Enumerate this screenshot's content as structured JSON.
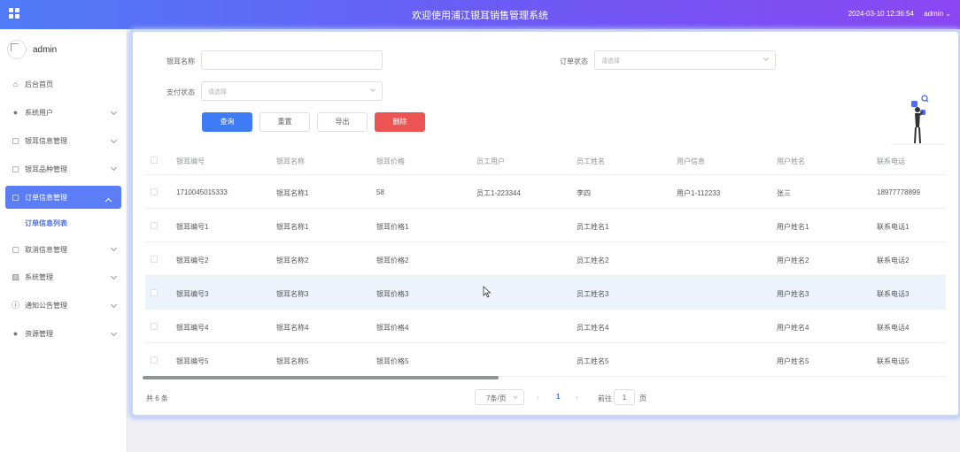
{
  "header": {
    "title": "欢迎使用浦江银耳销售管理系统",
    "datetime": "2024-03-10 12:36:54",
    "user": "admin"
  },
  "sidebar": {
    "username": "admin",
    "items": [
      {
        "label": "后台首页",
        "icon": "home-icon"
      },
      {
        "label": "系统用户",
        "icon": "user-icon"
      },
      {
        "label": "银耳信息管理",
        "icon": "doc-icon"
      },
      {
        "label": "银耳品种管理",
        "icon": "doc-icon"
      },
      {
        "label": "订单信息管理",
        "icon": "doc-icon"
      },
      {
        "label": "取消信息管理",
        "icon": "doc-icon"
      },
      {
        "label": "系统管理",
        "icon": "chart-icon"
      },
      {
        "label": "通知公告管理",
        "icon": "info-icon"
      },
      {
        "label": "资源管理",
        "icon": "pin-icon"
      }
    ],
    "sub_item": "订单信息列表"
  },
  "filters": {
    "name_label": "银耳名称",
    "name_placeholder": "",
    "order_status_label": "订单状态",
    "order_status_placeholder": "请选择",
    "pay_status_label": "支付状态",
    "pay_status_placeholder": "请选择"
  },
  "buttons": {
    "query": "查询",
    "reset": "重置",
    "export": "导出",
    "delete": "删除"
  },
  "table": {
    "headers": [
      "银耳编号",
      "银耳名称",
      "银耳价格",
      "员工用户",
      "员工姓名",
      "用户信息",
      "用户姓名",
      "联系电话"
    ],
    "rows": [
      [
        "1710045015333",
        "银耳名称1",
        "58",
        "员工1-223344",
        "李四",
        "用户1-112233",
        "张三",
        "18977778899"
      ],
      [
        "银耳编号1",
        "银耳名称1",
        "银耳价格1",
        "",
        "员工姓名1",
        "",
        "用户姓名1",
        "联系电话1"
      ],
      [
        "银耳编号2",
        "银耳名称2",
        "银耳价格2",
        "",
        "员工姓名2",
        "",
        "用户姓名2",
        "联系电话2"
      ],
      [
        "银耳编号3",
        "银耳名称3",
        "银耳价格3",
        "",
        "员工姓名3",
        "",
        "用户姓名3",
        "联系电话3"
      ],
      [
        "银耳编号4",
        "银耳名称4",
        "银耳价格4",
        "",
        "员工姓名4",
        "",
        "用户姓名4",
        "联系电话4"
      ],
      [
        "银耳编号5",
        "银耳名称5",
        "银耳价格5",
        "",
        "员工姓名5",
        "",
        "用户姓名5",
        "联系电话5"
      ]
    ]
  },
  "pagination": {
    "total": "共 6 条",
    "page_size": "7条/页",
    "current_page": "1",
    "goto_label": "前往",
    "goto_value": "1",
    "page_unit": "页"
  },
  "colors": {
    "primary": "#3d7bf7",
    "danger": "#ec5353",
    "header_gradient_start": "#4f7bf7",
    "header_gradient_end": "#8a46f2",
    "active_menu": "#5b7ef7"
  }
}
